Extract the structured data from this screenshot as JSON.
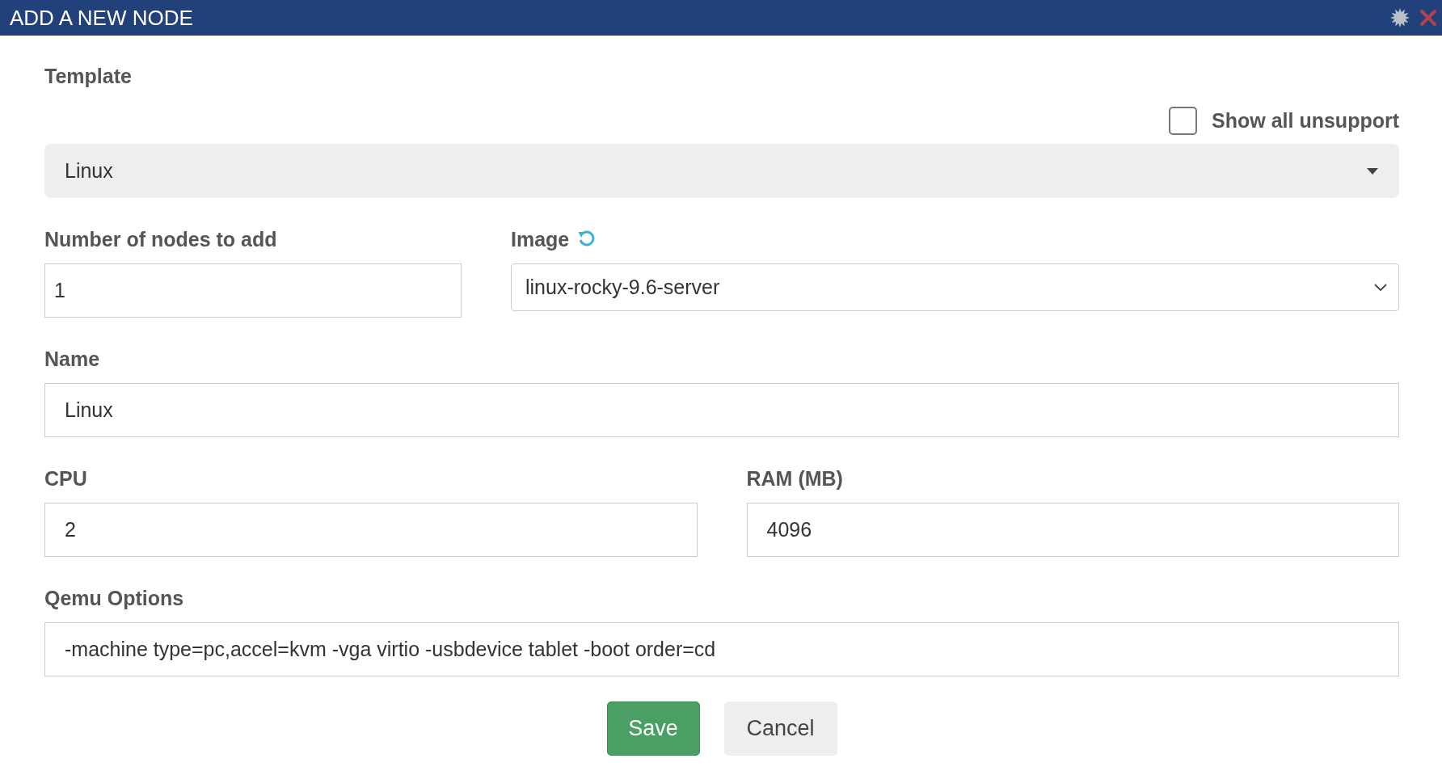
{
  "window": {
    "title": "ADD A NEW NODE"
  },
  "template": {
    "label": "Template",
    "show_unsupported": {
      "label": "Show all unsupport",
      "checked": false
    },
    "value": "Linux"
  },
  "number_of_nodes": {
    "label": "Number of nodes to add",
    "value": "1"
  },
  "image": {
    "label": "Image",
    "value": "linux-rocky-9.6-server"
  },
  "name": {
    "label": "Name",
    "value": "Linux"
  },
  "cpu": {
    "label": "CPU",
    "value": "2"
  },
  "ram": {
    "label": "RAM (MB)",
    "value": "4096"
  },
  "qemu_options": {
    "label": "Qemu Options",
    "value": "-machine type=pc,accel=kvm -vga virtio -usbdevice tablet -boot order=cd"
  },
  "buttons": [
    {
      "label": "Save",
      "kind": "primary"
    },
    {
      "label": "Cancel",
      "kind": "default"
    }
  ]
}
